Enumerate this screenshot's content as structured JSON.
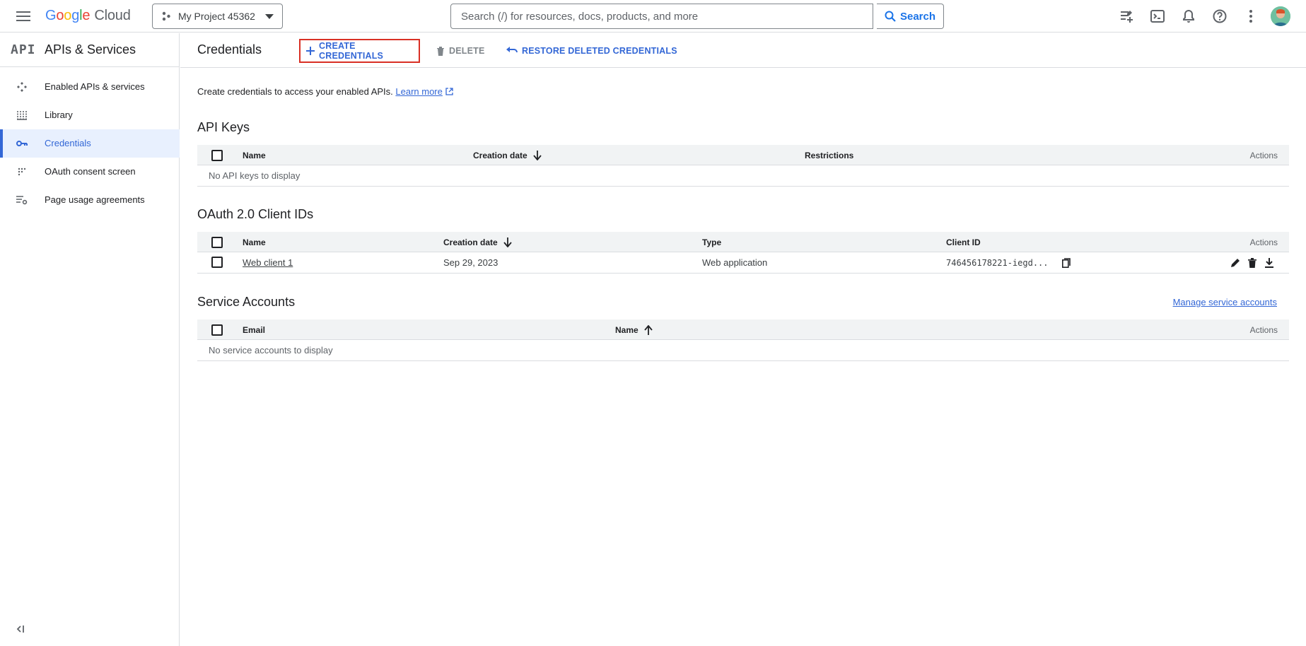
{
  "topbar": {
    "logo_letters": [
      "G",
      "o",
      "o",
      "g",
      "l",
      "e"
    ],
    "logo_suffix": "Cloud",
    "project_name": "My Project 45362",
    "search_placeholder": "Search (/) for resources, docs, products, and more",
    "search_button": "Search",
    "icons": [
      "notes-icon",
      "terminal-icon",
      "bell-icon",
      "help-icon",
      "more-vert-icon"
    ]
  },
  "sidebar": {
    "logo_text": "API",
    "title": "APIs & Services",
    "items": [
      {
        "label": "Enabled APIs & services",
        "icon": "enabled-apis-icon"
      },
      {
        "label": "Library",
        "icon": "library-icon"
      },
      {
        "label": "Credentials",
        "icon": "key-icon",
        "active": true
      },
      {
        "label": "OAuth consent screen",
        "icon": "oauth-icon"
      },
      {
        "label": "Page usage agreements",
        "icon": "settings-list-icon"
      }
    ]
  },
  "header": {
    "title": "Credentials",
    "create_label": "CREATE CREDENTIALS",
    "delete_label": "DELETE",
    "restore_label": "RESTORE DELETED CREDENTIALS"
  },
  "intro": {
    "text": "Create credentials to access your enabled APIs.",
    "link": "Learn more"
  },
  "api_keys": {
    "title": "API Keys",
    "columns": {
      "name": "Name",
      "creation_date": "Creation date",
      "restrictions": "Restrictions",
      "actions": "Actions"
    },
    "empty": "No API keys to display"
  },
  "oauth": {
    "title": "OAuth 2.0 Client IDs",
    "columns": {
      "name": "Name",
      "creation_date": "Creation date",
      "type": "Type",
      "client_id": "Client ID",
      "actions": "Actions"
    },
    "rows": [
      {
        "name": "Web client 1",
        "creation_date": "Sep 29, 2023",
        "type": "Web application",
        "client_id": "746456178221-iegd..."
      }
    ]
  },
  "service_accounts": {
    "title": "Service Accounts",
    "manage_link": "Manage service accounts",
    "columns": {
      "email": "Email",
      "name": "Name",
      "actions": "Actions"
    },
    "empty": "No service accounts to display"
  },
  "colors": {
    "accent": "#3367d6",
    "highlight_border": "#d93025",
    "active_bg": "#e8f0fe"
  }
}
